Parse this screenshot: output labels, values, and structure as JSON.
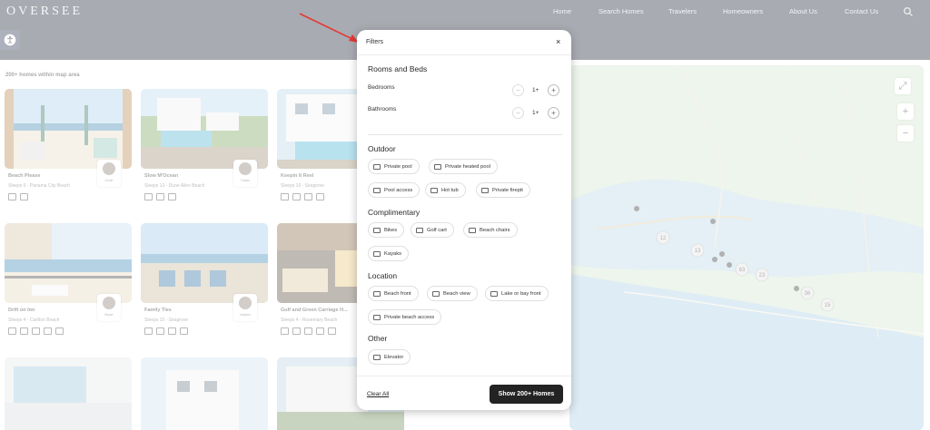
{
  "header": {
    "logo": "OVERSEE",
    "nav": [
      "Home",
      "Search Homes",
      "Travelers",
      "Homeowners",
      "About Us",
      "Contact Us"
    ]
  },
  "results": {
    "count_label": "200+ homes within map area"
  },
  "listings": [
    {
      "title": "Beach Please",
      "sub": "Sleeps 6 - Panama City Beach",
      "host": "Annie"
    },
    {
      "title": "Slow M'Ocean",
      "sub": "Sleeps 12 - Dune Allen Beach",
      "host": "Tristan"
    },
    {
      "title": "Keepin It Reel",
      "sub": "Sleeps 10 - Seagrove",
      "host": ""
    },
    {
      "title": "Drift on Inn",
      "sub": "Sleeps 4 - Carillon Beach",
      "host": "Skyler"
    },
    {
      "title": "Family Ties",
      "sub": "Sleeps 10 - Seagrove",
      "host": "Hayden"
    },
    {
      "title": "Gulf and Green Carriage H...",
      "sub": "Sleeps 4 - Rosemary Beach",
      "host": ""
    }
  ],
  "map": {
    "clusters": [
      "12",
      "13",
      "63",
      "23",
      "36",
      "15"
    ]
  },
  "filters": {
    "title": "Filters",
    "close": "×",
    "rooms": {
      "title": "Rooms and Beds",
      "bedrooms_label": "Bedrooms",
      "bedrooms_value": "1+",
      "bathrooms_label": "Bathrooms",
      "bathrooms_value": "1+",
      "minus": "−",
      "plus": "+"
    },
    "outdoor": {
      "title": "Outdoor",
      "chips": [
        "Private pool",
        "Private heated pool",
        "Pool access",
        "Hot tub",
        "Private firepit"
      ]
    },
    "complimentary": {
      "title": "Complimentary",
      "chips": [
        "Bikes",
        "Golf cart",
        "Beach chairs",
        "Kayaks"
      ]
    },
    "location": {
      "title": "Location",
      "chips": [
        "Beach front",
        "Beach view",
        "Lake or bay front",
        "Private beach access"
      ]
    },
    "other": {
      "title": "Other",
      "chips": [
        "Elevator"
      ]
    },
    "clear_all": "Clear All",
    "show_button": "Show 200+ Homes"
  },
  "colors": {
    "header_bg": "#1e2436",
    "button_dark": "#232323",
    "annotation_arrow": "#e53935"
  }
}
